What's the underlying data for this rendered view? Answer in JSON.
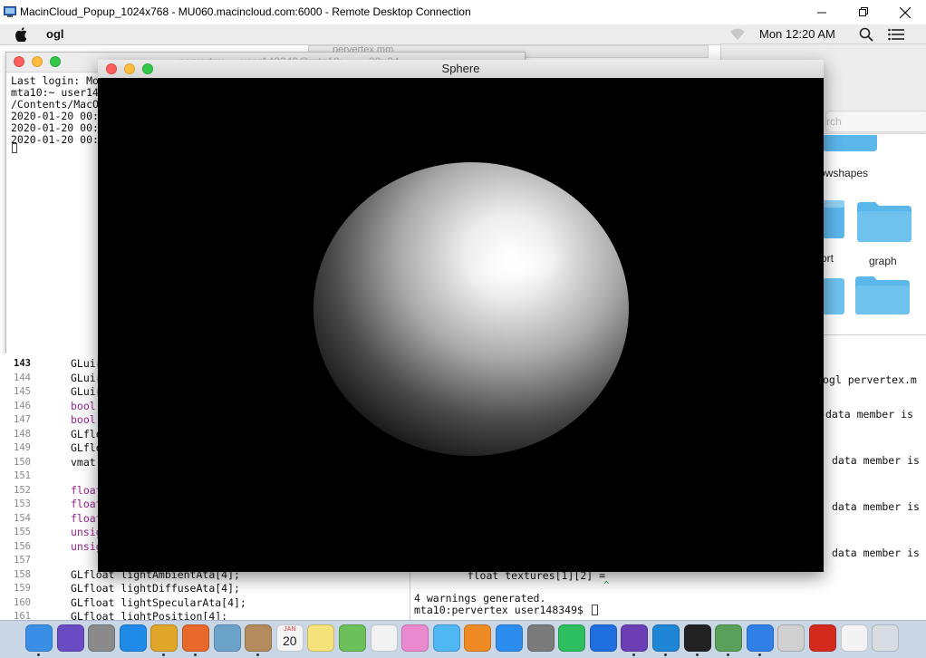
{
  "rdp": {
    "title": "MacinCloud_Popup_1024x768 - MU060.macincloud.com:6000 - Remote Desktop Connection",
    "minimize": "—",
    "restore": "❐",
    "close": "✕"
  },
  "menubar": {
    "app_name": "ogl",
    "clock": "Mon 12:20 AM"
  },
  "back_window": {
    "tab_title": "pervertex.mm"
  },
  "finder": {
    "search_placeholder": "rch",
    "items": [
      "owshapes",
      "ort",
      "graph"
    ]
  },
  "terminal": {
    "title": "pervertex — user148349@mta10: ~ — 80×24",
    "lines": [
      "Last login: Mo",
      "mta10:~ user14",
      "/Contents/MacO",
      "2020-01-20 00:",
      "2020-01-20 00:",
      "2020-01-20 00:"
    ]
  },
  "code": {
    "line_numbers": [
      "143",
      "144",
      "145",
      "146",
      "147",
      "148",
      "149",
      "150",
      "151",
      "152",
      "153",
      "154",
      "155",
      "156",
      "157",
      "158",
      "159",
      "160",
      "161"
    ],
    "lines": [
      {
        "text": "GLuir",
        "kw": false
      },
      {
        "text": "GLuir",
        "kw": false
      },
      {
        "text": "GLuir",
        "kw": false
      },
      {
        "text": "bool",
        "kw": true
      },
      {
        "text": "bool",
        "kw": true
      },
      {
        "text": "GLflo",
        "kw": false
      },
      {
        "text": "GLflo",
        "kw": false
      },
      {
        "text": "vmat",
        "kw": false
      },
      {
        "text": "",
        "kw": false
      },
      {
        "text": "float",
        "kw": true
      },
      {
        "text": "float",
        "kw": true
      },
      {
        "text": "float",
        "kw": true
      },
      {
        "text": "unsig",
        "kw": true
      },
      {
        "text": "unsig",
        "kw": true
      },
      {
        "text": "",
        "kw": false
      },
      {
        "text": "GLfloat lightAmbientAta[4];",
        "kw": false
      },
      {
        "text": "GLfloat lightDiffuseAta[4];",
        "kw": false
      },
      {
        "text": "GLfloat lightSpecularAta[4];",
        "kw": false
      },
      {
        "text": "GLfloat lightPosition[4];",
        "kw": false
      }
    ]
  },
  "console": {
    "cmd_line": "ogl pervertex.m",
    "warnings": [
      "data member is",
      "data member is",
      "data member is",
      "data member is"
    ],
    "code_snippet": "    float textures[1][2] =",
    "caret": "^",
    "summary": "4 warnings generated.",
    "prompt": "mta10:pervertex user148349$ "
  },
  "sphere_window": {
    "title": "Sphere"
  },
  "dock": {
    "items": [
      {
        "name": "finder-icon",
        "color": "#3a8ee6"
      },
      {
        "name": "siri-icon",
        "color": "#6a4bc4"
      },
      {
        "name": "launchpad-icon",
        "color": "#8a8a8a"
      },
      {
        "name": "safari-icon",
        "color": "#1f8ae8"
      },
      {
        "name": "chrome-icon",
        "color": "#e0a62a"
      },
      {
        "name": "firefox-icon",
        "color": "#e8672a"
      },
      {
        "name": "preview-icon",
        "color": "#6ca3c8"
      },
      {
        "name": "contacts-icon",
        "color": "#b38b5c"
      },
      {
        "name": "calendar-icon",
        "color": "#f4f4f4"
      },
      {
        "name": "notes-icon",
        "color": "#f6e27a"
      },
      {
        "name": "maps-icon",
        "color": "#6cbf5a"
      },
      {
        "name": "reminders-icon",
        "color": "#f2f2f2"
      },
      {
        "name": "photos-icon",
        "color": "#e98ad0"
      },
      {
        "name": "messages-icon",
        "color": "#4fb7f2"
      },
      {
        "name": "books-icon",
        "color": "#f08a24"
      },
      {
        "name": "app-store-icon",
        "color": "#2d8cf0"
      },
      {
        "name": "system-preferences-icon",
        "color": "#7b7b7b"
      },
      {
        "name": "evernote-icon",
        "color": "#2dbe60"
      },
      {
        "name": "dropbox-icon",
        "color": "#1f6fe0"
      },
      {
        "name": "visual-studio-icon",
        "color": "#6b3fb3"
      },
      {
        "name": "vscode-icon",
        "color": "#1f86d6"
      },
      {
        "name": "terminal-icon",
        "color": "#222222"
      },
      {
        "name": "android-studio-icon",
        "color": "#5aa05a"
      },
      {
        "name": "xcode-icon",
        "color": "#2f7fe6"
      },
      {
        "name": "instruments-icon",
        "color": "#d0d0d0"
      },
      {
        "name": "acrobat-icon",
        "color": "#d42a1e"
      },
      {
        "name": "documents-icon",
        "color": "#f3f3f3"
      },
      {
        "name": "trash-icon",
        "color": "#d8dde4"
      }
    ],
    "calendar_month": "JAN",
    "calendar_day": "20"
  }
}
